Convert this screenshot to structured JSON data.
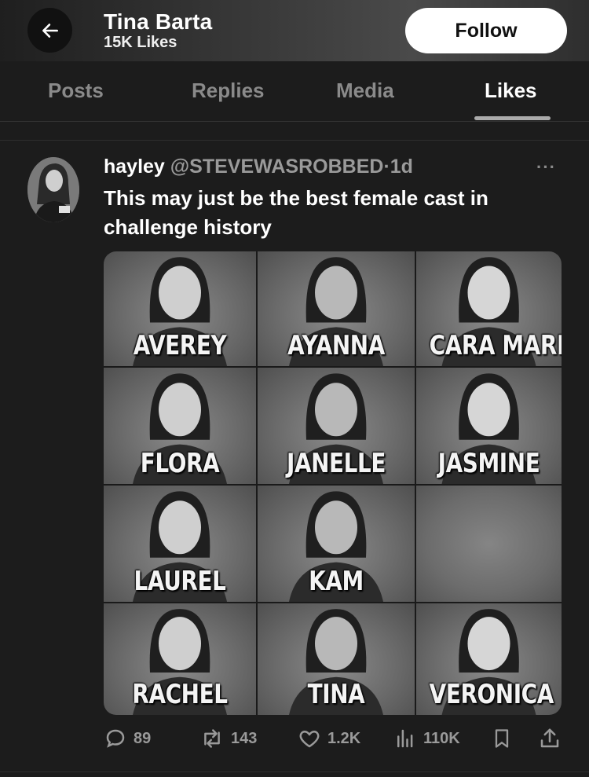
{
  "header": {
    "name": "Tina Barta",
    "subtitle": "15K Likes",
    "follow_label": "Follow"
  },
  "tabs": [
    {
      "label": "Posts",
      "active": false
    },
    {
      "label": "Replies",
      "active": false
    },
    {
      "label": "Media",
      "active": false
    },
    {
      "label": "Likes",
      "active": true
    }
  ],
  "tweet": {
    "author_name": "hayley",
    "author_handle": "@STEVEWASROBBED",
    "dot": "·",
    "time": "1d",
    "more": "···",
    "text": "This may just be the best female cast in challenge history",
    "media_names": [
      "AVEREY",
      "AYANNA",
      "CARA MARIA",
      "FLORA",
      "JANELLE",
      "JASMINE",
      "LAUREL",
      "KAM",
      "",
      "RACHEL",
      "TINA",
      "VERONICA"
    ],
    "stats": {
      "replies": "89",
      "reposts": "143",
      "likes": "1.2K",
      "views": "110K"
    }
  },
  "icons": {
    "back": "arrow-left-icon",
    "reply": "comment-icon",
    "repost": "repost-icon",
    "like": "heart-icon",
    "views": "bar-chart-icon",
    "bookmark": "bookmark-icon",
    "share": "share-icon"
  },
  "colors": {
    "background": "#1c1c1c",
    "muted": "#9a9a9a",
    "follow_bg": "#ffffff"
  }
}
